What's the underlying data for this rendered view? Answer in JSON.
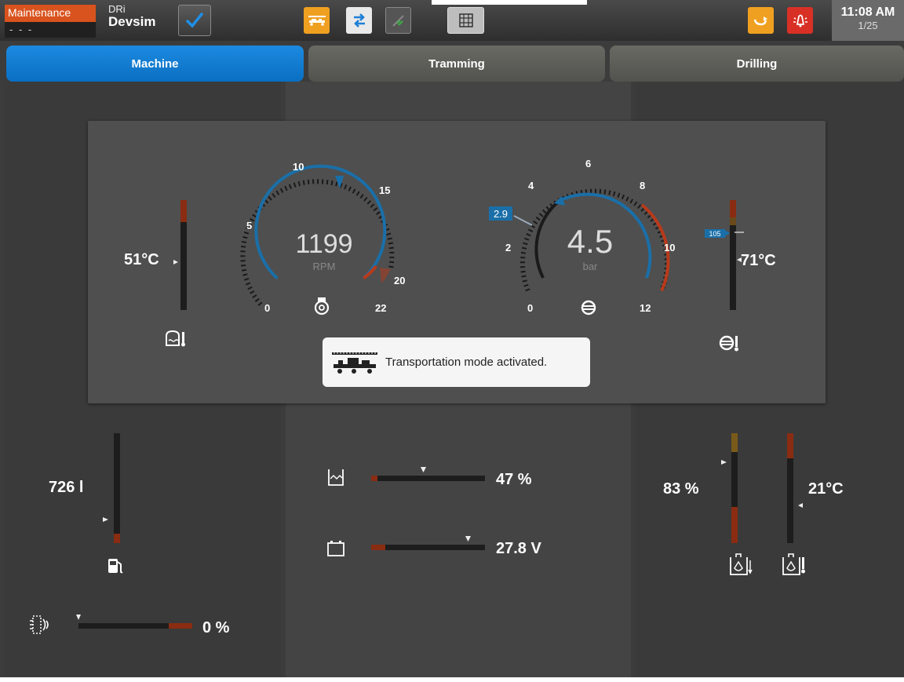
{
  "topbar": {
    "mode_label": "Maintenance",
    "mode_value": "- - -",
    "machine_small": "DRi",
    "machine_name": "Devsim",
    "time": "11:08 AM",
    "page": "1/25"
  },
  "tabs": [
    "Machine",
    "Tramming",
    "Drilling"
  ],
  "gauges": {
    "engine_rpm": {
      "value": "1199",
      "unit": "RPM",
      "ticks": [
        "0",
        "5",
        "10",
        "15",
        "20",
        "22"
      ],
      "needle": 1199
    },
    "pressure": {
      "value": "4.5",
      "unit": "bar",
      "ticks": [
        "0",
        "2",
        "4",
        "6",
        "8",
        "10",
        "12"
      ],
      "marker": "2.9"
    }
  },
  "coolant_temp": "51°C",
  "oil_temp": {
    "value": "71°C",
    "marker": "105"
  },
  "fuel": "726 l",
  "dpf_level": "0 %",
  "water_level": "47 %",
  "battery_voltage": "27.8 V",
  "hydraulic_oil_level": "83 %",
  "hydraulic_oil_temp": "21°C",
  "toast": {
    "message": "Transportation mode activated."
  },
  "colors": {
    "accent": "#0a6fc2",
    "orange": "#f0a020",
    "red": "#d93025",
    "gauge_blue": "#1a6fa8",
    "gauge_red": "#b83a1a"
  }
}
